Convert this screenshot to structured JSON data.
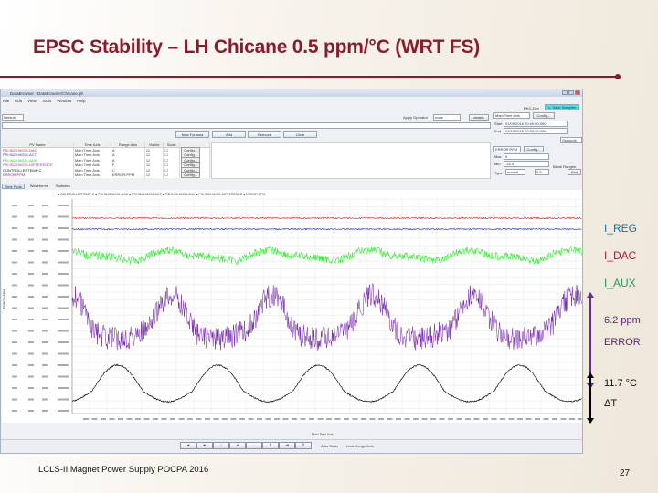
{
  "slide": {
    "title": "EPSC Stability – LH Chicane 0.5 ppm/°C (WRT FS)",
    "footer": "LCLS-II Magnet Power Supply POCPA 2016",
    "page_number": "27",
    "accent": "#8b1a2b"
  },
  "annotations": [
    {
      "label": "I_REG",
      "color": "#1f6f9a"
    },
    {
      "label": "I_DAC",
      "color": "#a0203a"
    },
    {
      "label": "I_AUX",
      "color": "#2a9a5a"
    },
    {
      "label": "6.2 ppm",
      "color": "#5a2a6a"
    },
    {
      "label": "ERROR",
      "color": "#5a2a6a"
    },
    {
      "label": "11.7 °C",
      "color": "#111111"
    },
    {
      "label": "ΔT",
      "color": "#111111"
    }
  ],
  "app": {
    "window_title": "DataBrowser - DataBrowser/Chicane.plt",
    "menu": [
      "File",
      "Edit",
      "View",
      "Tools",
      "Window",
      "Help"
    ],
    "pkg_label": "PKG-Dev",
    "save_button": "<- Save Samples",
    "preset": "Default",
    "apply_operator_label": "Apply Operator",
    "operator": "none",
    "details": "details",
    "time_axis_select": "Main Time Axis",
    "config_button": "Config...",
    "start_label": "Start",
    "start_value": "01/09/2016 20:00:00.000",
    "end_label": "End",
    "end_value": "01/13/2016 20:00:00.000",
    "seconds_select": "Seconds",
    "buttons": [
      "New Formula",
      "Add",
      "Remove",
      "Clear"
    ],
    "columns": [
      "PV Name",
      "Time Axis",
      "Range Axis",
      "Visible",
      "Scale",
      ""
    ],
    "rows": [
      {
        "name": "PSI:IN20:MG01:DAC",
        "time": "Main Time Axis",
        "range": "A",
        "color": "#d02020"
      },
      {
        "name": "PSI:IN20:MG01:ACT",
        "time": "Main Time Axis",
        "range": "A",
        "color": "#2030c0"
      },
      {
        "name": "PSI:IN20:MG01:AUX",
        "time": "Main Time Axis",
        "range": "A",
        "color": "#30c030"
      },
      {
        "name": "PSI:IN20:MG01:DIFFERENCE",
        "time": "Main Time Axis",
        "range": "F",
        "color": "#c020c0"
      },
      {
        "name": "CONTROLLERTEMP:C",
        "time": "Main Time Axis",
        "range": "C",
        "color": "#111111"
      },
      {
        "name": "ERROR:PPM",
        "time": "Main Time Axis",
        "range": "ERROR:PPM",
        "color": "#6a2aa0"
      }
    ],
    "row_config": "Config...",
    "axis_select": "ERROR:PPM",
    "axis_config": "Config...",
    "max_label": "Max",
    "max_value": "5",
    "min_label": "Min",
    "min_value": "-15.0",
    "blank_ranges": "Blank Ranges",
    "type_label": "Type",
    "type_value": "normal",
    "width_value": "0.5",
    "plot_button": "Plot",
    "tabs": [
      "Time Plots",
      "Waveforms",
      "Statistics"
    ],
    "legend": "■ CONTROLLERTEMP:C   ■ PSI:IN20:MG01:DAC   ■ PSI:IN20:MG01:ACT   ■ PSI:IN20:MG01:AUX   ■ PSI:IN20:MG01:DIFFERENCE   ■ ERROR:PPM",
    "x_axis_label": "Main Time Axis",
    "y_axis_label": "ERROR:PPM",
    "auto_scale": "Auto Scale",
    "lock_scale": "Lock Range Axis",
    "trace_colors": {
      "dac": "#e02020",
      "act": "#1a2aa8",
      "aux": "#33ee33",
      "error": "#6a1aa8",
      "temp": "#111111"
    }
  }
}
